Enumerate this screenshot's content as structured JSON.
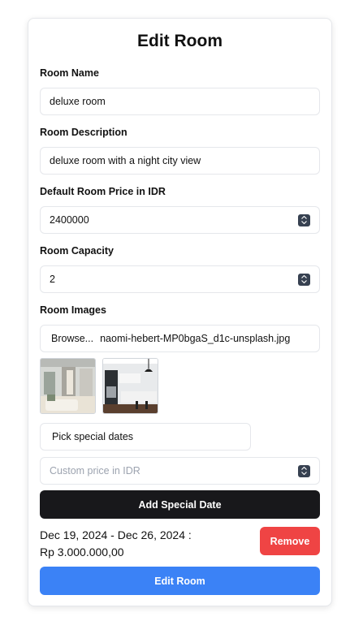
{
  "form": {
    "title": "Edit Room",
    "room_name": {
      "label": "Room Name",
      "value": "deluxe room"
    },
    "room_description": {
      "label": "Room Description",
      "value": "deluxe room with a night city view"
    },
    "room_price": {
      "label": "Default Room Price in IDR",
      "value": "2400000"
    },
    "room_capacity": {
      "label": "Room Capacity",
      "value": "2"
    },
    "room_images": {
      "label": "Room Images",
      "browse_label": "Browse...",
      "file_name": "naomi-hebert-MP0bgaS_d1c-unsplash.jpg",
      "thumbnails": [
        "room-photo-living",
        "room-photo-kitchen"
      ]
    },
    "special_dates": {
      "picker_value": "Pick special dates",
      "custom_price_placeholder": "Custom price in IDR",
      "add_button": "Add Special Date",
      "entry_dates": "Dec 19, 2024 - Dec 26, 2024 :",
      "entry_price": "Rp 3.000.000,00",
      "remove_button": "Remove"
    },
    "submit_button": "Edit Room"
  },
  "colors": {
    "primary_blue": "#3b82f6",
    "danger_red": "#ef4444",
    "dark_button": "#18181b"
  }
}
